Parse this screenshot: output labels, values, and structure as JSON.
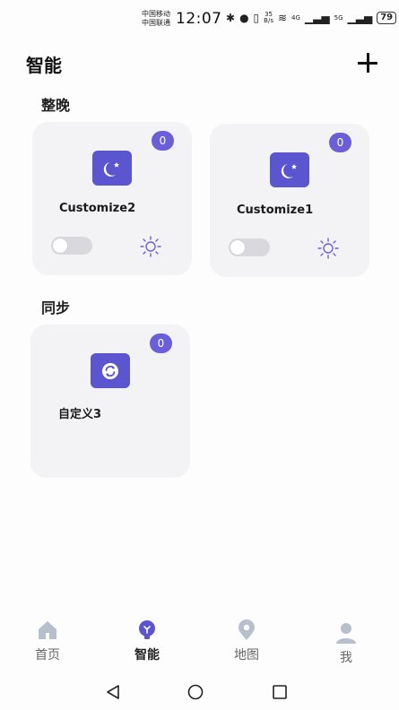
{
  "status_bar": {
    "carrier_1": "中国移动",
    "carrier_2": "中国联通",
    "time": "12:07",
    "net_speed_value": "35",
    "net_speed_unit": "B/s",
    "network_4g": "4G",
    "network_5g": "5G",
    "battery": "79"
  },
  "header": {
    "title": "智能"
  },
  "sections": {
    "night": {
      "title": "整晚",
      "cards": [
        {
          "label": "Customize2",
          "badge": "0",
          "icon": "moon-star-icon",
          "toggle_on": false
        },
        {
          "label": "Customize1",
          "badge": "0",
          "icon": "moon-star-icon",
          "toggle_on": false
        }
      ]
    },
    "sync": {
      "title": "同步",
      "cards": [
        {
          "label": "自定义3",
          "badge": "0",
          "icon": "sync-icon"
        }
      ]
    }
  },
  "bottom_nav": {
    "items": [
      {
        "label": "首页",
        "icon": "home-icon",
        "active": false
      },
      {
        "label": "智能",
        "icon": "smart-bulb-icon",
        "active": true
      },
      {
        "label": "地图",
        "icon": "map-pin-icon",
        "active": false
      },
      {
        "label": "我",
        "icon": "person-icon",
        "active": false
      }
    ]
  },
  "colors": {
    "accent": "#5b55cf",
    "badge": "#6a5fd8",
    "card_bg": "#f3f3f5",
    "inactive_icon": "#b8bfcc"
  }
}
